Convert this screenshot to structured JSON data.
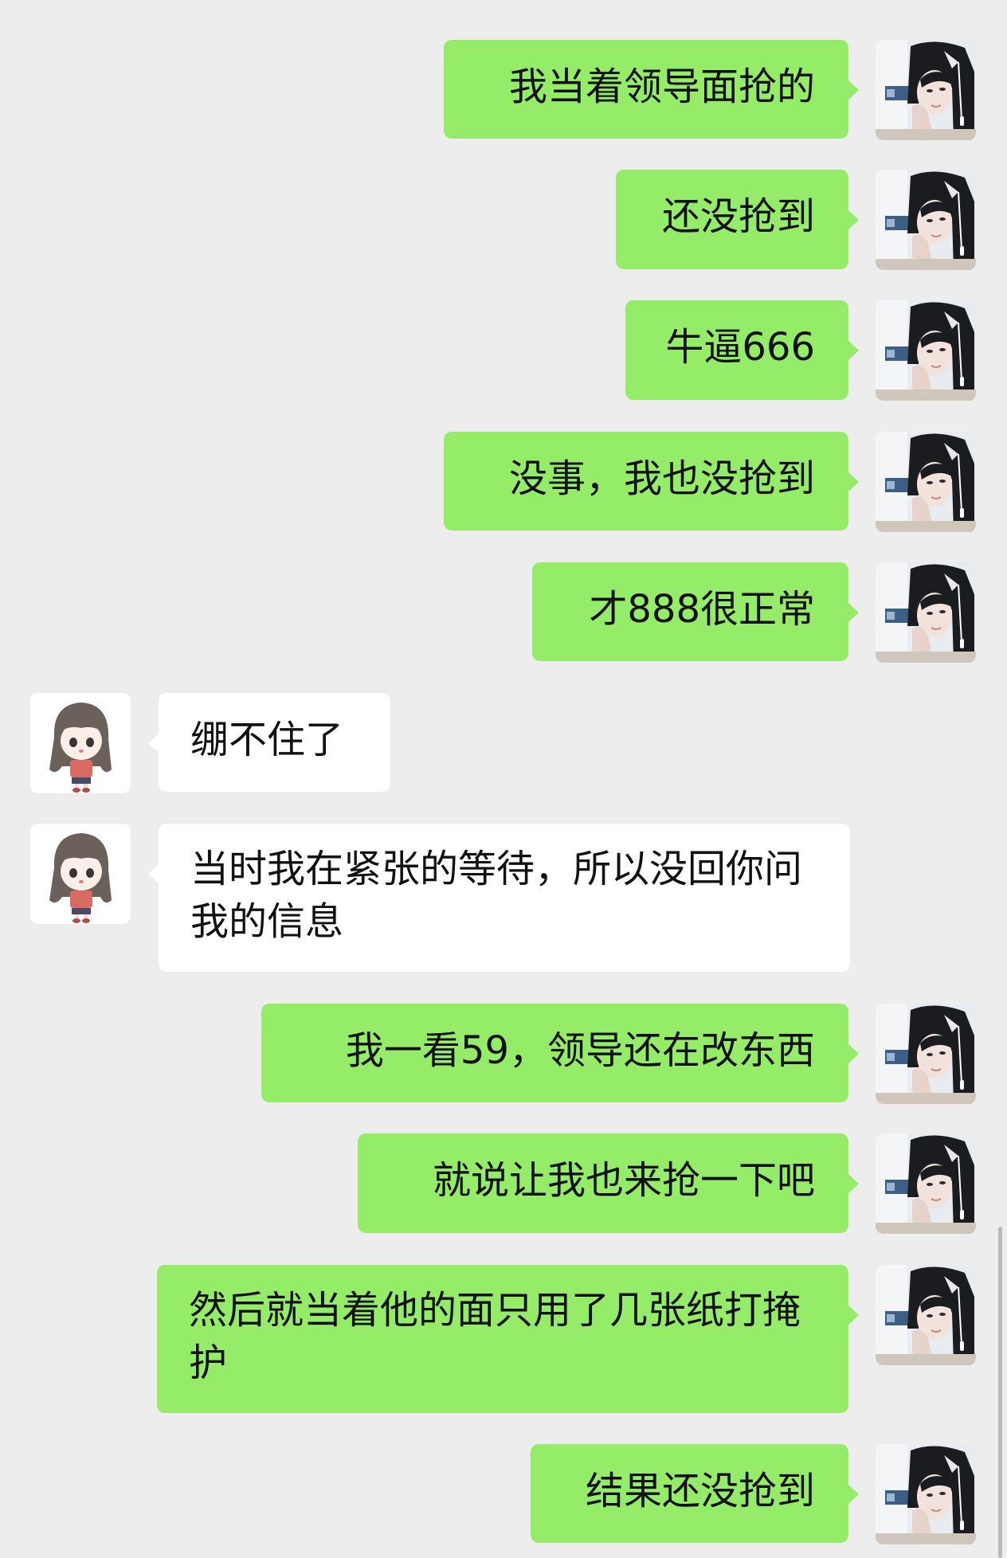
{
  "messages": [
    {
      "side": "out",
      "text": "我当着领导面抢的"
    },
    {
      "side": "out",
      "text": "还没抢到"
    },
    {
      "side": "out",
      "text": "牛逼666"
    },
    {
      "side": "out",
      "text": "没事，我也没抢到"
    },
    {
      "side": "out",
      "text": "才888很正常"
    },
    {
      "side": "in",
      "text": "绷不住了"
    },
    {
      "side": "in",
      "text": "当时我在紧张的等待，所以没回你问我的信息"
    },
    {
      "side": "out",
      "text": "我一看59，领导还在改东西"
    },
    {
      "side": "out",
      "text": "就说让我也来抢一下吧"
    },
    {
      "side": "out",
      "text": "然后就当着他的面只用了几张纸打掩护"
    },
    {
      "side": "out",
      "text": "结果还没抢到"
    }
  ],
  "colors": {
    "background": "#ededed",
    "outgoing_bubble": "#95ec69",
    "incoming_bubble": "#ffffff",
    "text": "#111111"
  },
  "icons": {
    "self_avatar": "photo-avatar",
    "other_avatar": "cartoon-girl-avatar"
  }
}
